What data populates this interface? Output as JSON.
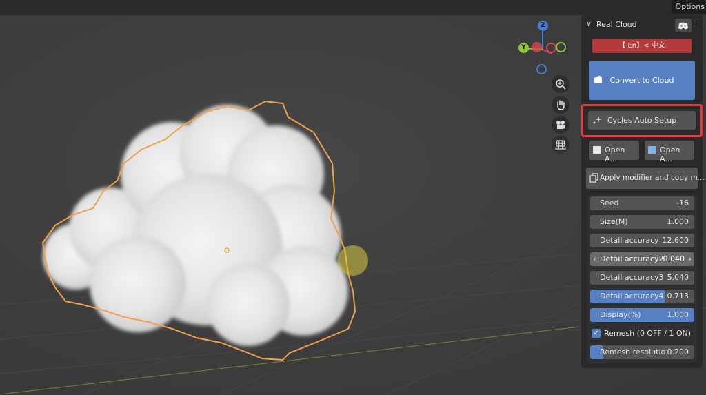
{
  "topbar": {
    "options_label": "Options"
  },
  "gizmo": {
    "z_label": "Z",
    "y_label": "Y"
  },
  "navigation": {
    "zoom_icon": "magnifier-plus-icon",
    "pan_icon": "hand-icon",
    "camera_icon": "camera-icon",
    "grid_icon": "grid-icon"
  },
  "panel": {
    "title": "Real Cloud",
    "language_button": "【 En】<  中文",
    "convert_button": "Convert to Cloud",
    "cycles_button": "Cycles Auto Setup",
    "open_button_1": "Open A...",
    "open_button_2": "Open A...",
    "apply_button": "Apply modifier and copy m...",
    "fields": [
      {
        "label": "Seed",
        "value": "-16"
      },
      {
        "label": "Size(M)",
        "value": "1.000"
      },
      {
        "label": "Detail accuracy",
        "value": "12.600"
      },
      {
        "label": "Detail accuracy2",
        "value": "0.040"
      },
      {
        "label": "Detail accuracy3",
        "value": "5.040"
      },
      {
        "label": "Detail accuracy4",
        "value": "0.713",
        "fill": 0.713
      },
      {
        "label": "Display(%)",
        "value": "1.000",
        "fill": 1.0
      },
      {
        "label": "Remesh (0 OFF / 1 ON)",
        "checked": true
      },
      {
        "label": "Remesh resolutio",
        "value": "0.200",
        "fill": 0.12
      }
    ]
  },
  "colors": {
    "accent_blue": "#5680c2",
    "language_red": "#b23a3a",
    "highlight_red": "#e03a3a",
    "selection_orange": "#f0a24a",
    "axis_x": "#d9434f",
    "axis_y": "#8ac53a",
    "axis_z": "#3f7fd4"
  }
}
